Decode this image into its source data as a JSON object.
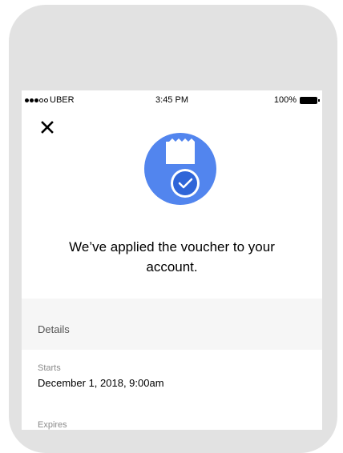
{
  "status_bar": {
    "carrier": "UBER",
    "time": "3:45 PM",
    "battery": "100%"
  },
  "icons": {
    "close": "close-icon",
    "voucher": "voucher-check-icon"
  },
  "colors": {
    "accent": "#5285ee",
    "accent_dark": "#2f65d8",
    "background": "#ffffff",
    "section_bg": "#f6f6f6"
  },
  "headline": {
    "line1": "We’ve applied the voucher to your",
    "line2": "account."
  },
  "details": {
    "section_label": "Details",
    "starts_label": "Starts",
    "starts_value": "December 1, 2018, 9:00am",
    "expires_label": "Expires"
  }
}
